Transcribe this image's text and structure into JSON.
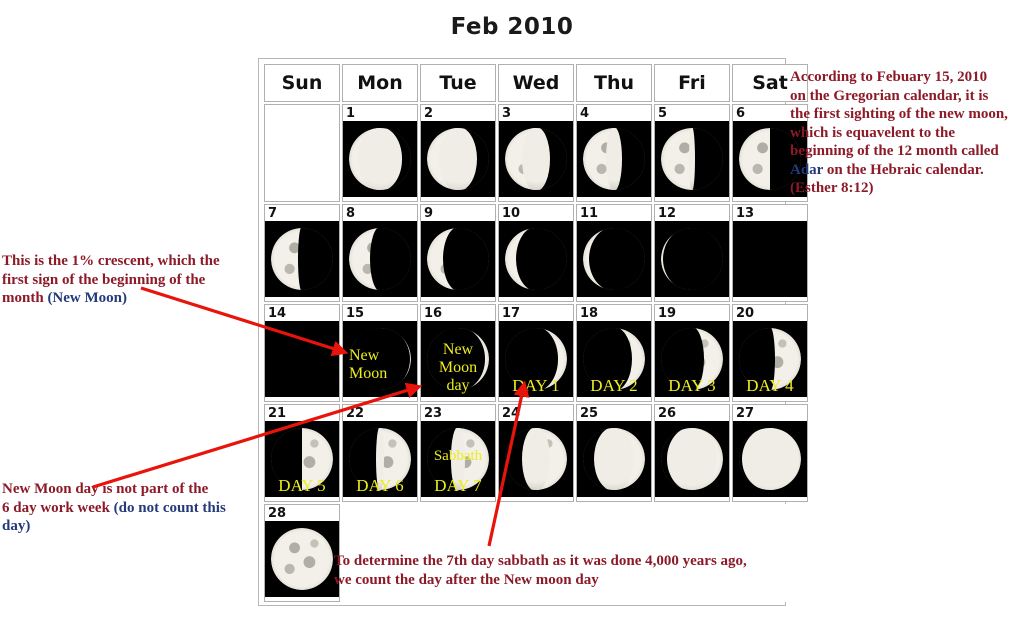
{
  "title": "Feb 2010",
  "calendar": {
    "weekday_headers": [
      "Sun",
      "Mon",
      "Tue",
      "Wed",
      "Thu",
      "Fri",
      "Sat"
    ],
    "weeks": [
      [
        {
          "day": "",
          "empty": true
        },
        {
          "day": "1",
          "phase": 0.86,
          "side": "left"
        },
        {
          "day": "2",
          "phase": 0.8,
          "side": "left"
        },
        {
          "day": "3",
          "phase": 0.72,
          "side": "left"
        },
        {
          "day": "4",
          "phase": 0.63,
          "side": "left"
        },
        {
          "day": "5",
          "phase": 0.55,
          "side": "left"
        },
        {
          "day": "6",
          "phase": 0.5,
          "side": "left"
        }
      ],
      [
        {
          "day": "7",
          "phase": 0.44,
          "side": "left"
        },
        {
          "day": "8",
          "phase": 0.34,
          "side": "left"
        },
        {
          "day": "9",
          "phase": 0.25,
          "side": "left"
        },
        {
          "day": "10",
          "phase": 0.18,
          "side": "left"
        },
        {
          "day": "11",
          "phase": 0.1,
          "side": "left"
        },
        {
          "day": "12",
          "phase": 0.04,
          "side": "left"
        },
        {
          "day": "13",
          "phase": 0.0,
          "side": "left"
        }
      ],
      [
        {
          "day": "14",
          "phase": 0.0,
          "side": "right"
        },
        {
          "day": "15",
          "phase": 0.02,
          "side": "right",
          "label_mid": "New\nMoon"
        },
        {
          "day": "16",
          "phase": 0.06,
          "side": "right",
          "label_mid": "New\nMoon\nday"
        },
        {
          "day": "17",
          "phase": 0.14,
          "side": "right",
          "label_bottom": "DAY 1"
        },
        {
          "day": "18",
          "phase": 0.21,
          "side": "right",
          "label_bottom": "DAY 2"
        },
        {
          "day": "19",
          "phase": 0.31,
          "side": "right",
          "label_bottom": "DAY 3"
        },
        {
          "day": "20",
          "phase": 0.42,
          "side": "right",
          "label_bottom": "DAY 4"
        }
      ],
      [
        {
          "day": "21",
          "phase": 0.5,
          "side": "right",
          "label_bottom": "DAY 5"
        },
        {
          "day": "22",
          "phase": 0.56,
          "side": "right",
          "label_bottom": "DAY 6"
        },
        {
          "day": "23",
          "phase": 0.62,
          "side": "right",
          "label_top": "Sabbath",
          "label_bottom": "DAY 7"
        },
        {
          "day": "24",
          "phase": 0.72,
          "side": "right"
        },
        {
          "day": "25",
          "phase": 0.82,
          "side": "right"
        },
        {
          "day": "26",
          "phase": 0.9,
          "side": "right"
        },
        {
          "day": "27",
          "phase": 0.96,
          "side": "right"
        }
      ],
      [
        {
          "day": "28",
          "phase": 1.0,
          "side": "right"
        }
      ]
    ]
  },
  "annotations": {
    "right": {
      "line1": "According to Febuary 15, 2010",
      "line2": "on the Gregorian calendar, it is",
      "line3": "the first sighting of the new moon,",
      "line4": "which is equavelent to the",
      "line5": "beginning of the 12 month called",
      "line6_highlight": "Adar",
      "line6_rest": " on the Hebraic calendar.",
      "line7": "(Esther 8:12)"
    },
    "left_top": {
      "line1": "This is the 1% crescent, which the",
      "line2": "first sign of the beginning of the",
      "line3": "month ",
      "line3_highlight": "(New Moon)"
    },
    "left_bottom": {
      "line1": "New Moon day is not part of the",
      "line2": "6 day work week ",
      "line2_highlight": "(do not count this",
      "line3_highlight": "day)"
    },
    "bottom": {
      "line1": "To determine the 7th day sabbath as it was done 4,000 years ago,",
      "line2": "we count the day after the New moon day"
    }
  },
  "colors": {
    "annotation_red": "#8c1a28",
    "annotation_blue": "#243a7a",
    "cell_label_yellow": "#eded1e",
    "arrow_red": "#e8140c",
    "moon_dark": "#000000"
  }
}
